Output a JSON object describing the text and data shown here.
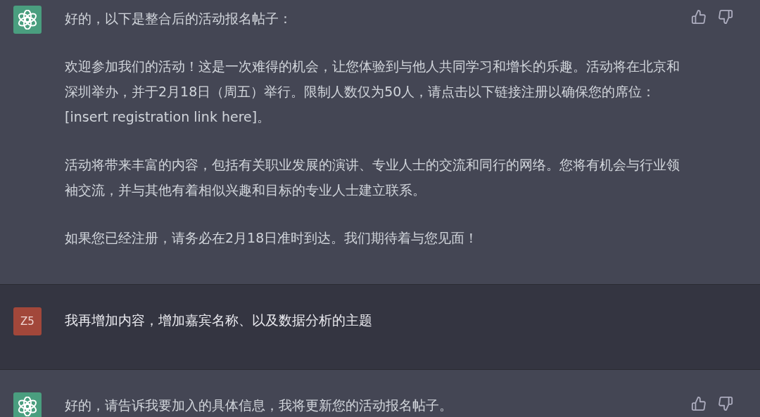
{
  "messages": [
    {
      "kind": "assistant",
      "paragraphs": [
        "好的，以下是整合后的活动报名帖子：",
        "欢迎参加我们的活动！这是一次难得的机会，让您体验到与他人共同学习和增长的乐趣。活动将在北京和深圳举办，并于2月18日（周五）举行。限制人数仅为50人，请点击以下链接注册以确保您的席位：[insert registration link here]。",
        "活动将带来丰富的内容，包括有关职业发展的演讲、专业人士的交流和同行的网络。您将有机会与行业领袖交流，并与其他有着相似兴趣和目标的专业人士建立联系。",
        "如果您已经注册，请务必在2月18日准时到达。我们期待着与您见面！"
      ]
    },
    {
      "kind": "user",
      "avatar_text": "Z5",
      "paragraphs": [
        "我再增加内容，增加嘉宾名称、以及数据分析的主题"
      ]
    },
    {
      "kind": "assistant",
      "paragraphs": [
        "好的，请告诉我要加入的具体信息，我将更新您的活动报名帖子。"
      ]
    }
  ]
}
